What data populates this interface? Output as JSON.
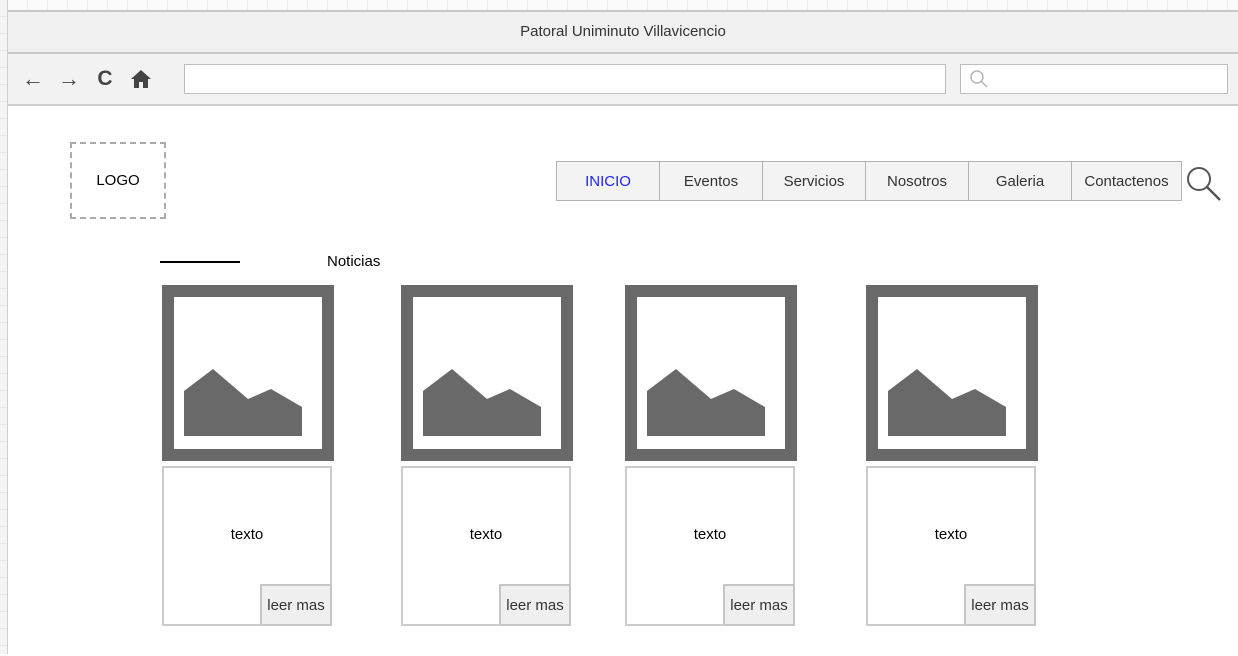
{
  "window": {
    "title": "Patoral Uniminuto Villavicencio"
  },
  "toolbar": {
    "back_icon": "←",
    "forward_icon": "→",
    "reload_icon": "C",
    "home_icon": "home-icon",
    "url_value": "",
    "search_value": ""
  },
  "header": {
    "logo_label": "LOGO",
    "menu": [
      "INICIO",
      "Eventos",
      "Servicios",
      "Nosotros",
      "Galeria",
      "Contactenos"
    ],
    "active_item": "INICIO",
    "active_color": "#1f1fff"
  },
  "news": {
    "title": "Noticias",
    "cards": [
      {
        "text": "texto",
        "button": "leer mas"
      },
      {
        "text": "texto",
        "button": "leer mas"
      },
      {
        "text": "texto",
        "button": "leer mas"
      },
      {
        "text": "texto",
        "button": "leer mas"
      }
    ]
  }
}
